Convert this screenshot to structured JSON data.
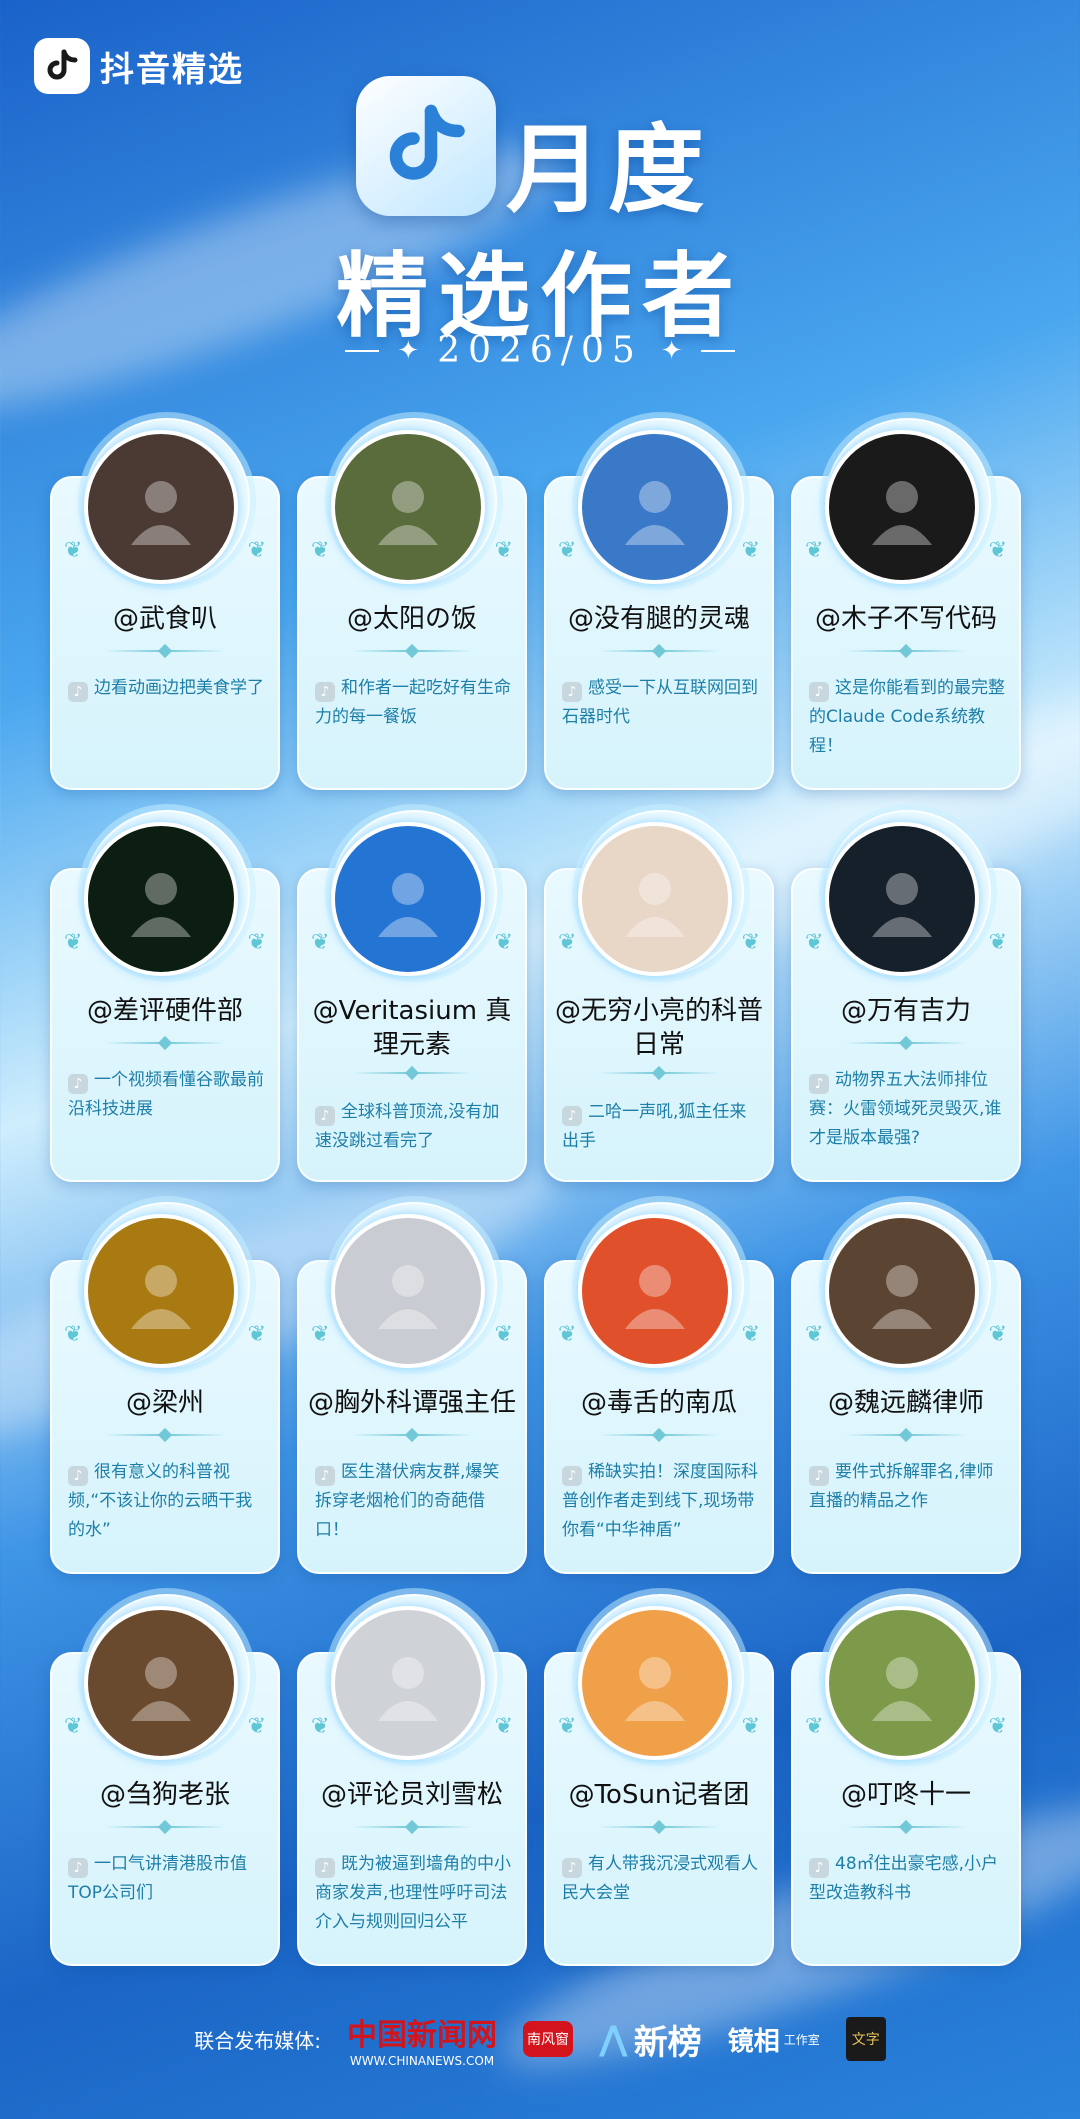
{
  "app": {
    "brand": "抖音精选"
  },
  "header": {
    "title_line1": "月度",
    "title_line2": "精选作者",
    "period": "2026/05"
  },
  "creators": [
    {
      "name": "@武食叭",
      "desc": "边看动画边把美食学了",
      "avatar_color": "#4a3a33"
    },
    {
      "name": "@太阳の饭",
      "desc": "和作者一起吃好有生命力的每一餐饭",
      "avatar_color": "#5a6b3c"
    },
    {
      "name": "@没有腿的灵魂",
      "desc": "感受一下从互联网回到石器时代",
      "avatar_color": "#3a78c8"
    },
    {
      "name": "@木子不写代码",
      "desc": "这是你能看到的最完整的Claude Code系统教程！",
      "avatar_color": "#1a1a1a"
    },
    {
      "name": "@差评硬件部",
      "desc": "一个视频看懂谷歌最前沿科技进展",
      "avatar_color": "#0c1d12"
    },
    {
      "name": "@Veritasium 真理元素",
      "desc": "全球科普顶流,没有加速没跳过看完了",
      "avatar_color": "#2474d3"
    },
    {
      "name": "@无穷小亮的科普日常",
      "desc": "二哈一声吼,狐主任来出手",
      "avatar_color": "#e8d6c6"
    },
    {
      "name": "@万有吉力",
      "desc": "动物界五大法师排位赛：火雷领域死灵毁灭,谁才是版本最强?",
      "avatar_color": "#15202a"
    },
    {
      "name": "@梁州",
      "desc": "很有意义的科普视频,“不该让你的云晒干我的水”",
      "avatar_color": "#a97a12"
    },
    {
      "name": "@胸外科谭强主任",
      "desc": "医生潜伏病友群,爆笑拆穿老烟枪们的奇葩借口！",
      "avatar_color": "#c9ccd2"
    },
    {
      "name": "@毒舌的南瓜",
      "desc": "稀缺实拍！深度国际科普创作者走到线下,现场带你看“中华神盾”",
      "avatar_color": "#e0502a"
    },
    {
      "name": "@魏远麟律师",
      "desc": "要件式拆解罪名,律师直播的精品之作",
      "avatar_color": "#5b4431"
    },
    {
      "name": "@刍狗老张",
      "desc": "一口气讲清港股市值TOP公司们",
      "avatar_color": "#6a4a2e"
    },
    {
      "name": "@评论员刘雪松",
      "desc": "既为被逼到墙角的中小商家发声,也理性呼吁司法介入与规则回归公平",
      "avatar_color": "#cfd3d8"
    },
    {
      "name": "@ToSun记者团",
      "desc": "有人带我沉浸式观看人民大会堂",
      "avatar_color": "#f1a04a"
    },
    {
      "name": "@叮咚十一",
      "desc": "48㎡住出豪宅感,小户型改造教科书",
      "avatar_color": "#7d9a4a"
    }
  ],
  "footer": {
    "label": "联合发布媒体:",
    "media": [
      "中国新闻网",
      "WWW.CHINANEWS.COM",
      "南风窗",
      "新榜",
      "镜相",
      "工作室",
      "文字"
    ]
  },
  "colors": {
    "accent": "#1d7fa8",
    "panel": "#e9f9ff"
  }
}
